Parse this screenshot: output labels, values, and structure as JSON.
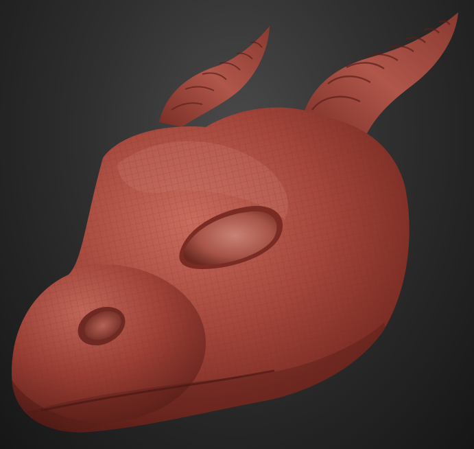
{
  "scene": {
    "subject": "dragon-head-sculpt",
    "colors": {
      "background_light": "#4a4a4a",
      "background_dark": "#161616",
      "clay_base": "#9c3f35",
      "clay_light": "#c66a5c",
      "clay_shadow": "#4e1a15",
      "mesh_line": "#6a2620"
    }
  }
}
